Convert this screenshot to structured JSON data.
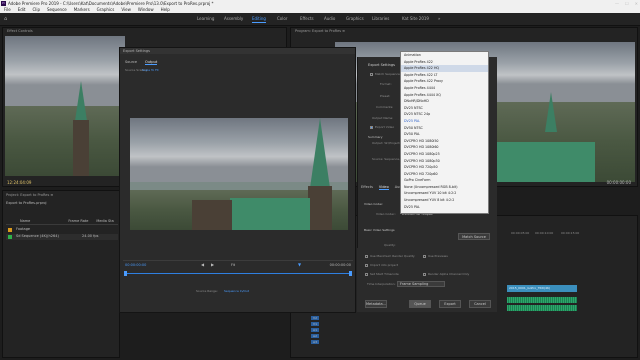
{
  "window": {
    "title": "Adobe Premiere Pro 2019 - C:\\Users\\Kat\\Documents\\Adobe\\Premiere Pro\\13.0\\Export to ProRes.prproj *",
    "app_icon": "Pr",
    "controls": [
      "—",
      "☐",
      "✕"
    ]
  },
  "menu": [
    "File",
    "Edit",
    "Clip",
    "Sequence",
    "Markers",
    "Graphics",
    "View",
    "Window",
    "Help"
  ],
  "workspaces": {
    "home_icon": "home-icon",
    "tabs": [
      "Learning",
      "Assembly",
      "Editing",
      "Color",
      "Effects",
      "Audio",
      "Graphics",
      "Libraries",
      "Kat Site 2019"
    ],
    "active": "Editing",
    "more": "»"
  },
  "source_panel": {
    "tab": "Effect Controls",
    "timecode": "12:24:04:09"
  },
  "program_panel": {
    "tab": "Program: Export to ProRes ≡",
    "timecode": "00:00:00:00"
  },
  "project_panel": {
    "tab": "Project: Export to ProRes ≡",
    "bin": "Export to ProRes.prproj",
    "columns": [
      "Name",
      "Frame Rate",
      "Media Sta"
    ],
    "rows": [
      {
        "name": "Footage",
        "rate": "",
        "color": "#d99a1f"
      },
      {
        "name": "Sd Sequence (4K)(h264)",
        "rate": "24.00 fps",
        "color": "#2fb24a"
      }
    ]
  },
  "export_dialog": {
    "title": "Export Settings",
    "tabs": [
      "Source",
      "Output"
    ],
    "source_scaling_label": "Source Scaling:",
    "source_scaling_value": "Scale To Fit",
    "timecode_start": "00:00:00:00",
    "timecode_end": "00:00:00:00",
    "fit": "Fit",
    "source_range_label": "Source Range:",
    "source_range_value": "Sequence In/Out"
  },
  "export_settings": {
    "header": "Export Settings",
    "match_sequence": "Match Sequence Settings",
    "format_label": "Format:",
    "preset_label": "Preset:",
    "comments_label": "Comments:",
    "output_name_label": "Output Name:",
    "export_video": "Export Video",
    "export_audio": "Export Audio",
    "summary": "Summary",
    "summary_output": "Output: W:\\Projects\\Export\\...",
    "summary_source": "Source: Sequence, Sd Sequence...",
    "tabs": [
      "Effects",
      "Video",
      "Audio",
      "Captions",
      "Publish"
    ],
    "video_codec_section": "Video Codec",
    "video_codec_label": "Video Codec:",
    "video_codec_value": "DVCPRO HD 720p60",
    "basic_video_settings": "Basic Video Settings",
    "match_source": "Match Source",
    "quality_label": "Quality:",
    "use_max_render": "Use Maximum Render Quality",
    "use_previews": "Use Previews",
    "import_into_project": "Import into project",
    "set_start_timecode": "Set Start Timecode",
    "render_alpha": "Render Alpha Channel Only",
    "time_interp_label": "Time Interpolation:",
    "time_interp_value": "Frame Sampling",
    "metadata_button": "Metadata...",
    "queue_button": "Queue",
    "export_button": "Export",
    "cancel_button": "Cancel"
  },
  "codec_list": {
    "items": [
      "Animation",
      "Apple ProRes 422",
      "Apple ProRes 422 HQ",
      "Apple ProRes 422 LT",
      "Apple ProRes 422 Proxy",
      "Apple ProRes 4444",
      "Apple ProRes 4444 XQ",
      "DNxHR/DNxHD",
      "DV25 NTSC",
      "DV25 NTSC 24p",
      "DV25 PAL",
      "DV50 NTSC",
      "DV50 PAL",
      "DVCPRO HD 1080i50",
      "DVCPRO HD 1080i60",
      "DVCPRO HD 1080p25",
      "DVCPRO HD 1080p30",
      "DVCPRO HD 720p50",
      "DVCPRO HD 720p60",
      "GoPro CineForm",
      "None (Uncompressed RGB 8-bit)",
      "Uncompressed YUV 10 bit 4:2:2",
      "Uncompressed YUV 8 bit 4:2:2",
      "DV25 PAL"
    ],
    "selected_index": 2,
    "highlight_index": 10
  },
  "timeline": {
    "ruler": [
      "00:00:05:00",
      "00:00:10:00",
      "00:00:15:00"
    ],
    "tracks": [
      "V2",
      "V1",
      "A1",
      "A2",
      "A3"
    ],
    "clip_label": "2015_0001_GoPro_TRD(4K)"
  },
  "colors": {
    "accent": "#4a9cff",
    "audio": "#2aa86b",
    "clip": "#3b8fbd"
  }
}
